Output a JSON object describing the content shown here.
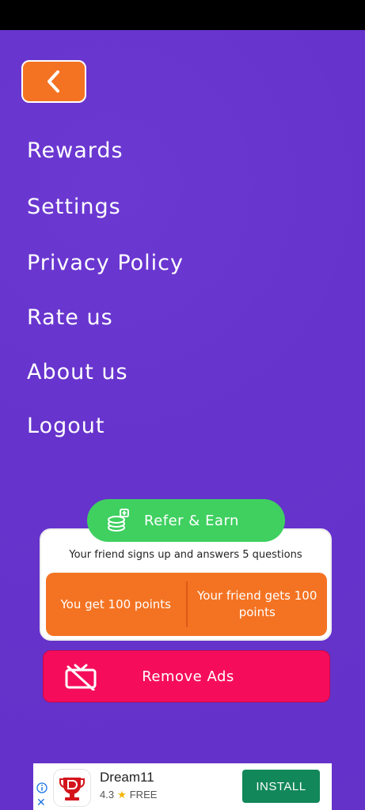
{
  "menu": {
    "items": [
      {
        "label": "Rewards"
      },
      {
        "label": "Settings"
      },
      {
        "label": "Privacy Policy"
      },
      {
        "label": "Rate us"
      },
      {
        "label": "About us"
      },
      {
        "label": "Logout"
      }
    ]
  },
  "back_button": {
    "icon": "chevron-left-icon"
  },
  "refer": {
    "button_label": "Refer & Earn",
    "description": "Your friend signs up and answers 5 questions",
    "you_get": "You get 100 points",
    "friend_gets": "Your friend gets 100 points"
  },
  "remove_ads": {
    "label": "Remove Ads",
    "icon": "no-tv-icon"
  },
  "ad": {
    "app_name": "Dream11",
    "rating": "4.3",
    "price": "FREE",
    "install_label": "INSTALL"
  },
  "colors": {
    "background": "#6633cc",
    "back_button": "#f47322",
    "refer_pill": "#3fd060",
    "reward_box": "#f47322",
    "remove_ads": "#f50d5c",
    "install": "#12875a"
  }
}
